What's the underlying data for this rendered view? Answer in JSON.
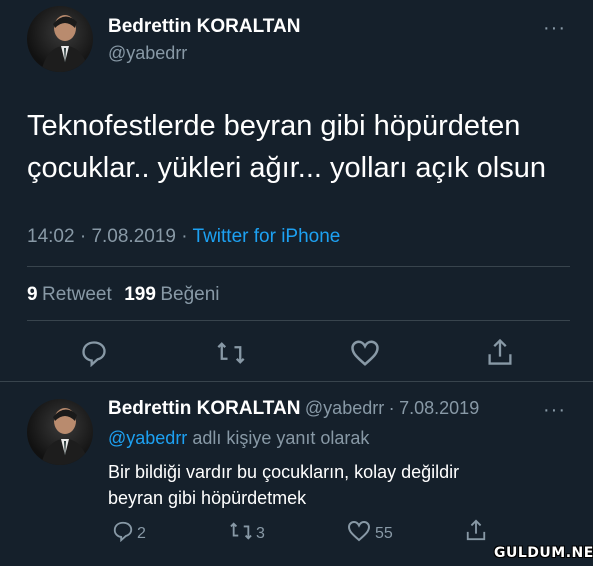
{
  "main_tweet": {
    "author_name": "Bedrettin KORALTAN",
    "author_handle": "@yabedrr",
    "text_line1": "Teknofestlerde beyran gibi höpürdeten",
    "text_line2": "çocuklar.. yükleri ağır... yolları açık olsun",
    "time": "14:02",
    "date": "7.08.2019",
    "source": "Twitter for iPhone",
    "retweet_count": "9",
    "retweet_label": "Retweet",
    "like_count": "199",
    "like_label": "Beğeni",
    "more_label": "···",
    "separator": "·"
  },
  "reply": {
    "author_name": "Bedrettin KORALTAN",
    "author_handle": "@yabedrr",
    "date": "7.08.2019",
    "separator": "·",
    "replying_to_handle": "@yabedrr",
    "replying_to_suffix": "adlı kişiye yanıt olarak",
    "text_line1": "Bir bildiği vardır bu çocukların, kolay değildir",
    "text_line2": "beyran gibi höpürdetmek",
    "reply_count": "2",
    "retweet_count": "3",
    "like_count": "55",
    "more_label": "···"
  },
  "watermark": "GULDUM.NET",
  "icons": [
    "reply-icon",
    "retweet-icon",
    "like-icon",
    "share-icon"
  ],
  "colors": {
    "background": "#15202b",
    "accent": "#1da1f2",
    "muted": "#8899a6",
    "divider": "#38444d"
  }
}
